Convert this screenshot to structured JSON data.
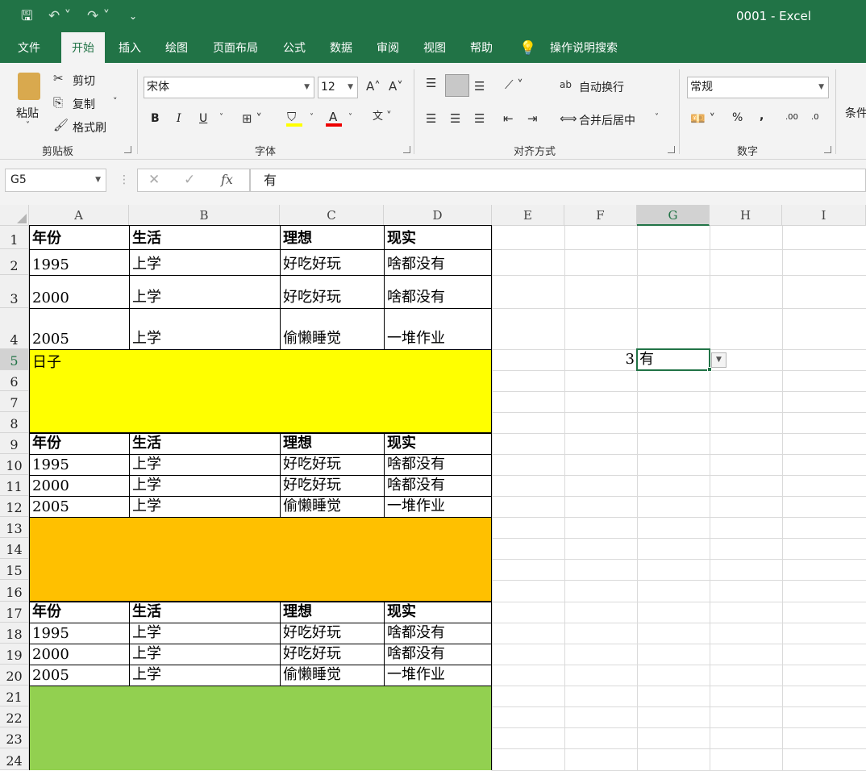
{
  "window": {
    "title": "0001  -  Excel"
  },
  "quick_access": {
    "save_icon": "save-icon",
    "undo_icon": "undo-icon",
    "redo_icon": "redo-icon",
    "customize_icon": "customize-icon"
  },
  "tabs": [
    "文件",
    "开始",
    "插入",
    "绘图",
    "页面布局",
    "公式",
    "数据",
    "审阅",
    "视图",
    "帮助"
  ],
  "search_label": "操作说明搜索",
  "ribbon": {
    "clipboard": {
      "paste": "粘贴",
      "cut": "剪切",
      "copy": "复制",
      "format_painter": "格式刷",
      "group": "剪贴板"
    },
    "font": {
      "name": "宋体",
      "size": "12",
      "bold": "B",
      "italic": "I",
      "underline": "U",
      "group": "字体"
    },
    "alignment": {
      "wrap": "自动换行",
      "merge": "合并后居中",
      "group": "对齐方式"
    },
    "number": {
      "format": "常规",
      "percent": "%",
      "comma": ",",
      "inc_decimal": ".00",
      "dec_decimal": ".0",
      "group": "数字"
    },
    "styles": {
      "conditional": "条件"
    }
  },
  "formula_bar": {
    "name_box": "G5",
    "cancel": "✕",
    "enter": "✓",
    "fx": "fx",
    "content": "有"
  },
  "colors": {
    "accent": "#217346",
    "yellow": "#FFFF00",
    "orange": "#FFC000",
    "green": "#92D050"
  },
  "columns": [
    "A",
    "B",
    "C",
    "D",
    "E",
    "F",
    "G",
    "H",
    "I"
  ],
  "rows": [
    "1",
    "2",
    "3",
    "4",
    "5",
    "6",
    "7",
    "8",
    "9",
    "10",
    "11",
    "12",
    "13",
    "14",
    "15",
    "16",
    "17",
    "18",
    "19",
    "20",
    "21",
    "22",
    "23",
    "24"
  ],
  "sheet": {
    "header": [
      "年份",
      "生活",
      "理想",
      "现实"
    ],
    "table1": [
      [
        "1995",
        "上学",
        "好吃好玩",
        "啥都没有"
      ],
      [
        "2000",
        "上学",
        "好吃好玩",
        "啥都没有"
      ],
      [
        "2005",
        "上学",
        "偷懒睡觉",
        "一堆作业"
      ]
    ],
    "merged_label": "日子",
    "table2": [
      [
        "1995",
        "上学",
        "好吃好玩",
        "啥都没有"
      ],
      [
        "2000",
        "上学",
        "好吃好玩",
        "啥都没有"
      ],
      [
        "2005",
        "上学",
        "偷懒睡觉",
        "一堆作业"
      ]
    ],
    "table3": [
      [
        "1995",
        "上学",
        "好吃好玩",
        "啥都没有"
      ],
      [
        "2000",
        "上学",
        "好吃好玩",
        "啥都没有"
      ],
      [
        "2005",
        "上学",
        "偷懒睡觉",
        "一堆作业"
      ]
    ],
    "f5": "3",
    "g5": "有"
  }
}
